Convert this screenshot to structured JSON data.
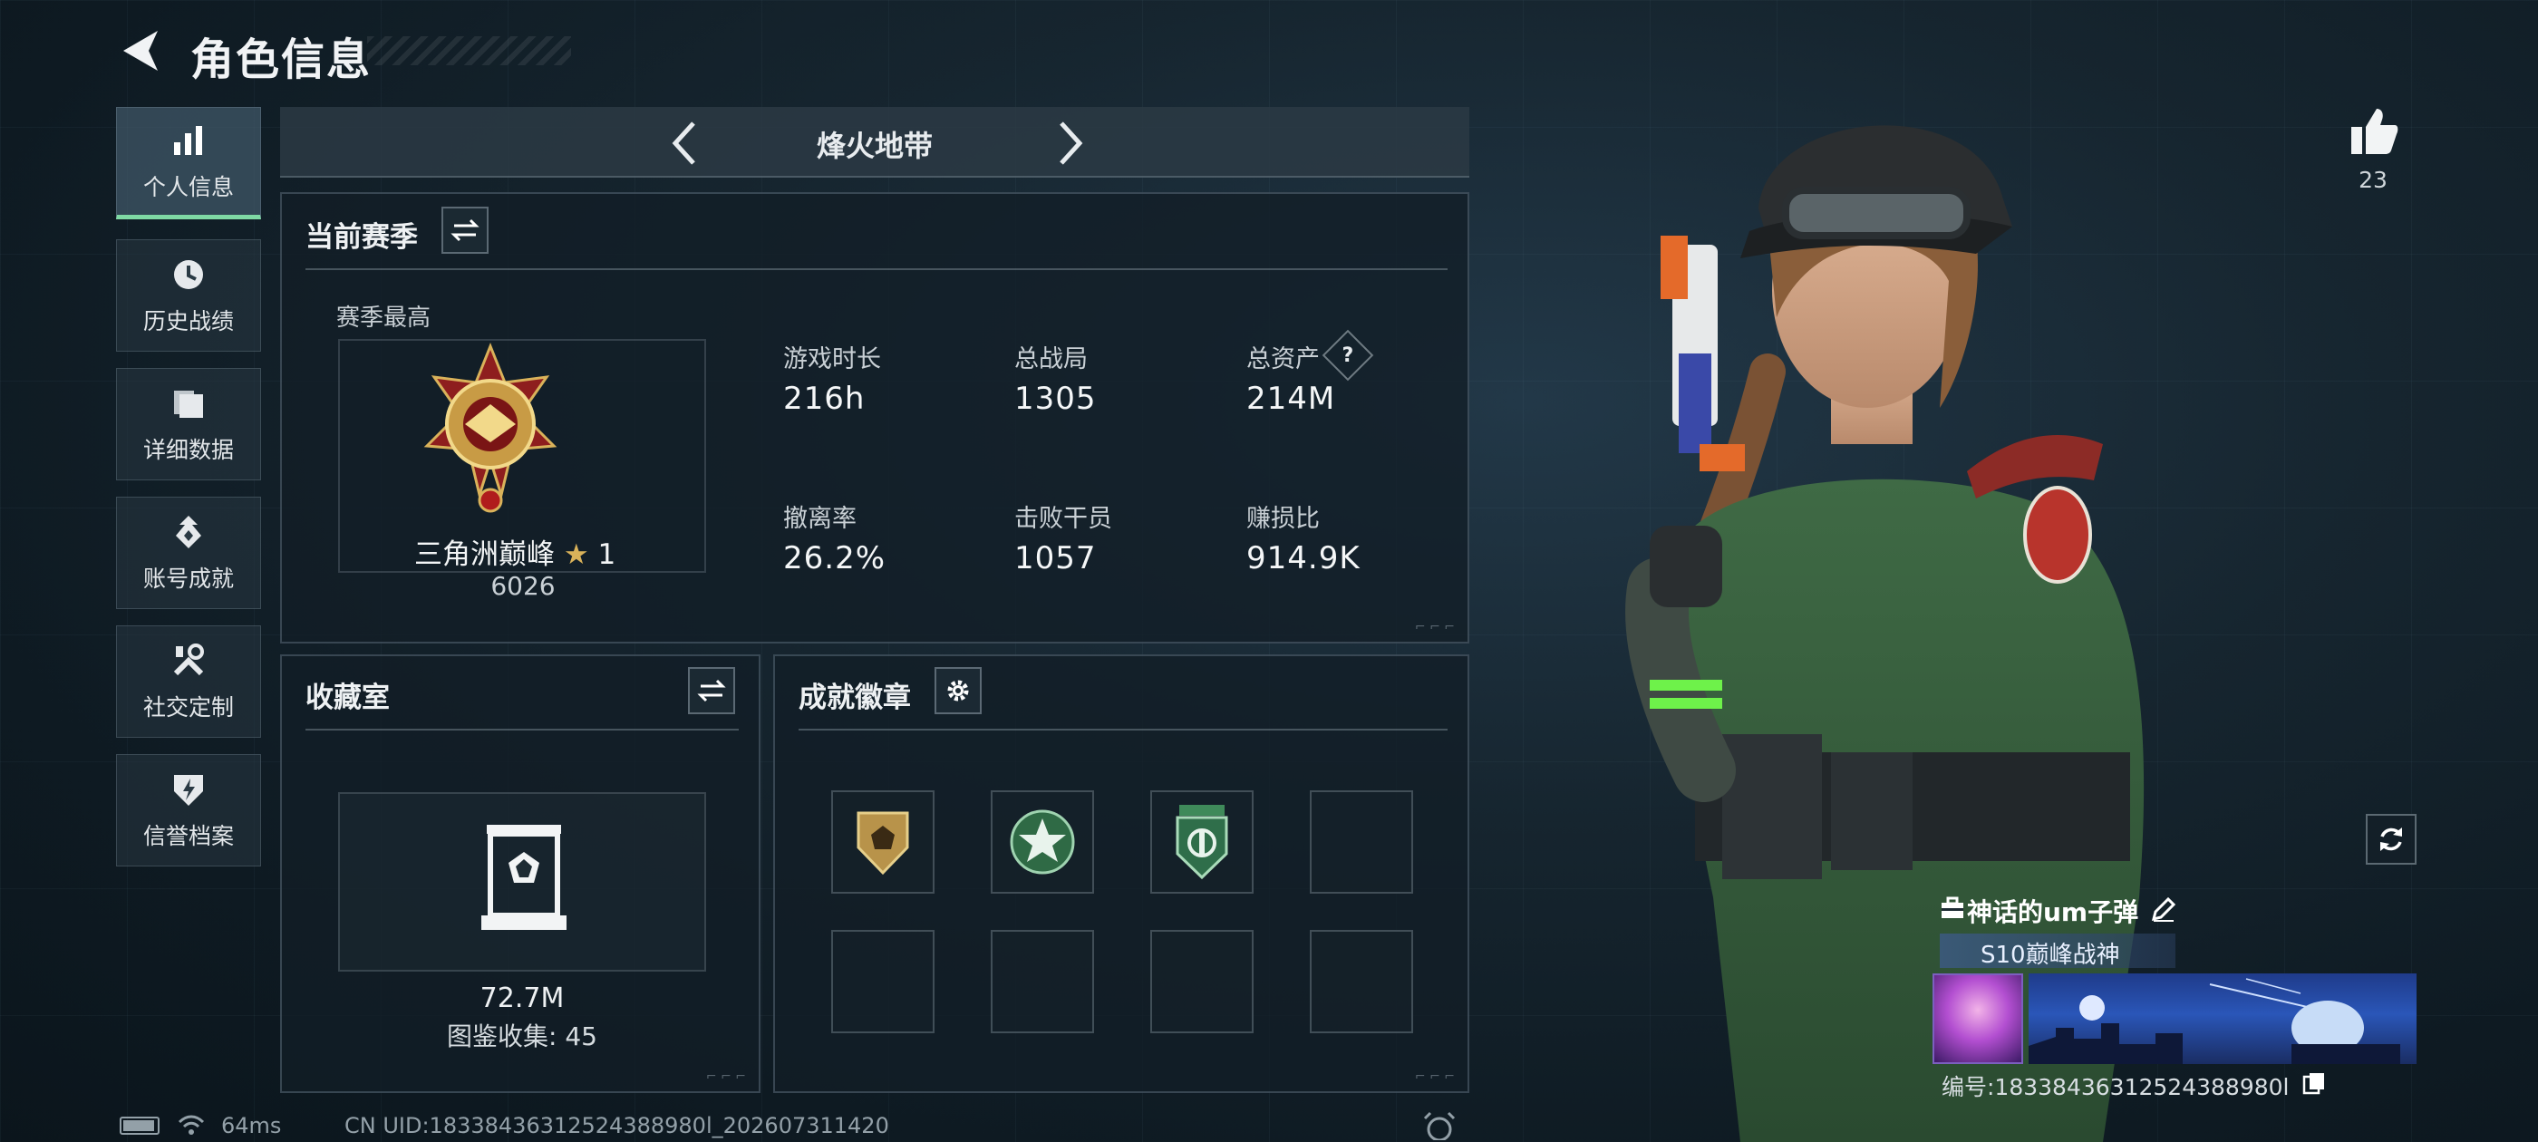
{
  "header": {
    "title": "角色信息"
  },
  "sidebar": {
    "items": [
      {
        "label": "个人信息",
        "icon": "bar-chart-icon",
        "active": true
      },
      {
        "label": "历史战绩",
        "icon": "clock-icon"
      },
      {
        "label": "详细数据",
        "icon": "folder-icon"
      },
      {
        "label": "账号成就",
        "icon": "achievement-icon"
      },
      {
        "label": "社交定制",
        "icon": "tools-icon"
      },
      {
        "label": "信誉档案",
        "icon": "shield-icon"
      }
    ]
  },
  "mode": {
    "title": "烽火地带"
  },
  "season": {
    "title": "当前赛季",
    "best_label": "赛季最高",
    "rank_name": "三角洲巅峰",
    "rank_stars": "1",
    "rank_score": "6026",
    "stats": [
      {
        "label": "游戏时长",
        "value": "216h"
      },
      {
        "label": "总战局",
        "value": "1305"
      },
      {
        "label": "总资产",
        "value": "214M",
        "help": "?"
      },
      {
        "label": "撤离率",
        "value": "26.2%"
      },
      {
        "label": "击败干员",
        "value": "1057"
      },
      {
        "label": "赚损比",
        "value": "914.9K"
      }
    ]
  },
  "collection": {
    "title": "收藏室",
    "value": "72.7M",
    "count_text": "图鉴收集: 45"
  },
  "badges": {
    "title": "成就徽章",
    "slots": [
      {
        "icon": "shield-badge-icon",
        "color": "#b8934a"
      },
      {
        "icon": "star-badge-icon",
        "color": "#3f8a5a"
      },
      {
        "icon": "wing-badge-icon",
        "color": "#2f6e4a"
      },
      {
        "icon": ""
      },
      {
        "icon": ""
      },
      {
        "icon": ""
      },
      {
        "icon": ""
      },
      {
        "icon": ""
      }
    ]
  },
  "likes": {
    "count": "23"
  },
  "player": {
    "name": "神话的um子弹",
    "rank_tag": "S10巅峰战神",
    "id_text": "编号:18338436312524388980l"
  },
  "status_bar": {
    "ping": "64ms",
    "uid": "CN UID:18338436312524388980l_202607311420"
  },
  "colors": {
    "accent": "#7fd9a4",
    "panel": "#121e26"
  }
}
